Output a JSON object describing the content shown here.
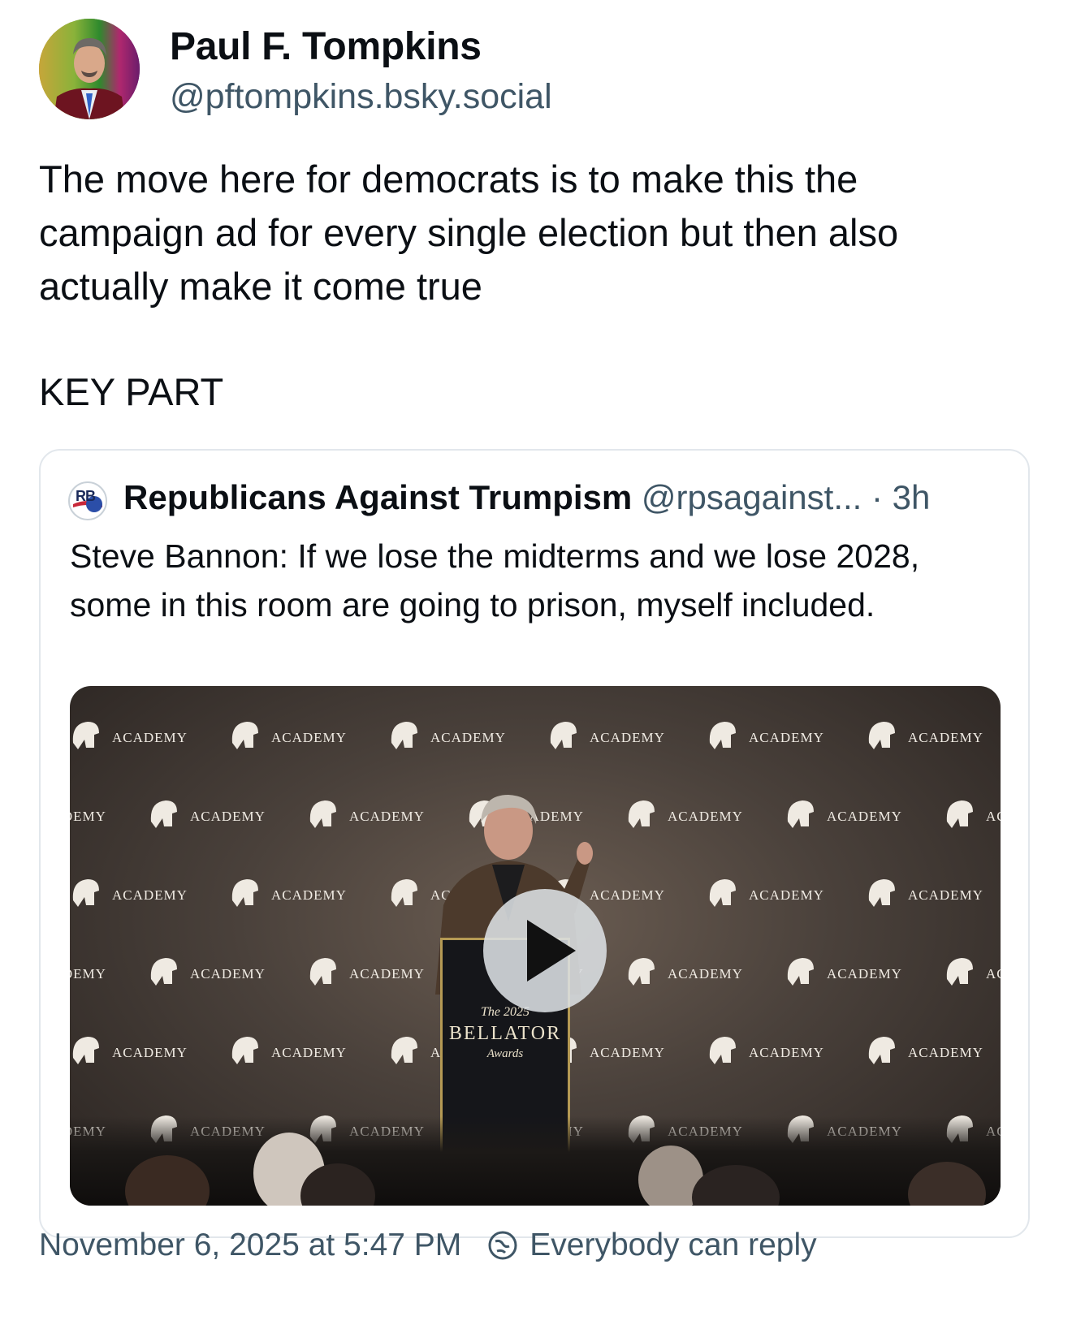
{
  "post": {
    "author_name": "Paul F. Tompkins",
    "author_handle": "@pftompkins.bsky.social",
    "text": "The move here for democrats is to make this the\ncampaign ad for every single election but then also\nactually make it come true",
    "key_part": "KEY PART"
  },
  "quote": {
    "avatar_initials": "RB",
    "author_name": "Republicans Against Trumpism",
    "author_handle": "@rpsagainst...",
    "separator": "·",
    "time": "3h",
    "text": "Steve Bannon: If we lose the midterms and we lose 2028, some in this room are going to prison, myself included.",
    "video": {
      "backdrop_word": "ACADEMY",
      "podium_line1": "The 2025",
      "podium_line2": "BELLATOR",
      "podium_line3": "Awards"
    }
  },
  "footer": {
    "timestamp": "November 6, 2025 at 5:47 PM",
    "reply_setting": "Everybody can reply"
  },
  "colors": {
    "text_primary": "#0b0f14",
    "text_secondary": "#3f5666",
    "border": "#e2e7ec"
  },
  "icons": {
    "play": "play-icon",
    "reply_setting": "globe-reply-icon"
  }
}
